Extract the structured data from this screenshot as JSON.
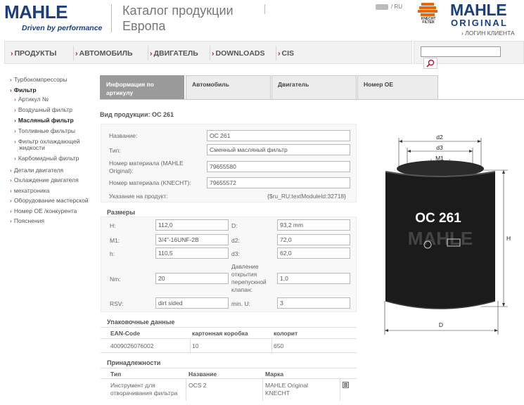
{
  "header": {
    "logo": "MAHLE",
    "tagline": "Driven by performance",
    "title_line1": "Каталог продукции",
    "title_line2": "Европа",
    "lang": "RU",
    "brand_knecht": "KNECHT FILTER",
    "brand_mahle": "MAHLE",
    "brand_original": "ORIGINAL",
    "login": "ЛОГИН КЛИЕНТА"
  },
  "nav": {
    "items": [
      "ПРОДУКТЫ",
      "АВТОМОБИЛЬ",
      "ДВИГАТЕЛЬ",
      "DOWNLOADS",
      "CIS"
    ],
    "search_placeholder": ""
  },
  "sidebar": {
    "items": [
      {
        "label": "Турбокомпрессоры",
        "level": 0
      },
      {
        "label": "Фильтр",
        "level": 0,
        "bold": true
      },
      {
        "label": "Артикул №",
        "level": 1
      },
      {
        "label": "Воздушный фильтр",
        "level": 1
      },
      {
        "label": "Масляный фильтр",
        "level": 1,
        "bold": true
      },
      {
        "label": "Топливные фильтры",
        "level": 1
      },
      {
        "label": "Фильтр охлаждающей",
        "level": 1
      },
      {
        "label": "жидкости",
        "level": 1,
        "cont": true
      },
      {
        "label": "Карбомидный фильтр",
        "level": 1
      },
      {
        "label": "Детали двигателя",
        "level": 0
      },
      {
        "label": "Охлаждение двигателя",
        "level": 0
      },
      {
        "label": "мехатроника",
        "level": 0
      },
      {
        "label": "Оборудование мастерской",
        "level": 0
      },
      {
        "label": "Номер OE /конкурента",
        "level": 0
      },
      {
        "label": "Пояснения",
        "level": 0
      }
    ]
  },
  "tabs": [
    {
      "label": "Информация по артикулу",
      "active": true
    },
    {
      "label": "Автомобиль",
      "active": false
    },
    {
      "label": "Двигатель",
      "active": false
    },
    {
      "label": "Номер OE",
      "active": false
    }
  ],
  "product": {
    "title": "Вид продукции: OC 261",
    "general": [
      {
        "label": "Название:",
        "value": "OC 261"
      },
      {
        "label": "Тип:",
        "value": "Сменный масляный фильтр"
      },
      {
        "label": "Номер материала (MAHLE Original):",
        "value": "79655580"
      },
      {
        "label": "Номер материала (KNECHT):",
        "value": "79655572"
      }
    ],
    "note_label": "Указание на продукт:",
    "note_value": "{$ru_RU:textModuleId:32718}"
  },
  "dimensions": {
    "title": "Размеры",
    "left": [
      {
        "label": "H:",
        "value": "112,0"
      },
      {
        "label": "M1:",
        "value": "3/4\"-16UNF-2B"
      },
      {
        "label": "h:",
        "value": "110,5"
      },
      {
        "label": "Nm:",
        "value": "20"
      },
      {
        "label": "RSV:",
        "value": "dirt sided"
      }
    ],
    "right": [
      {
        "label": "D:",
        "value": "93,2 mm"
      },
      {
        "label": "d2:",
        "value": "72,0"
      },
      {
        "label": "d3:",
        "value": "62,0"
      },
      {
        "label": "Давление открытия перепускной клапан:",
        "value": "1,0"
      },
      {
        "label": "min. U:",
        "value": "3"
      }
    ]
  },
  "packaging": {
    "title": "Упаковочные данные",
    "headers": [
      "EAN-Code",
      "картонная коробка",
      "колорит"
    ],
    "row": [
      "4009026076002",
      "10",
      "650"
    ]
  },
  "accessories": {
    "title": "Принадлежности",
    "headers": [
      "Тип",
      "Название",
      "Марка"
    ],
    "row": [
      "Инструмент для отворачивания фильтра",
      "OCS 2",
      "MAHLE Original KNECHT"
    ]
  },
  "image": {
    "labels": {
      "d2": "d2",
      "d3": "d3",
      "m1": "M1",
      "h": "H",
      "d": "D"
    },
    "filter_text": "OC 261",
    "filter_brand": "MAHLE"
  },
  "colors": {
    "brand_blue": "#1b3f7c",
    "accent_red": "#c8102e",
    "orange": "#e8670c"
  }
}
